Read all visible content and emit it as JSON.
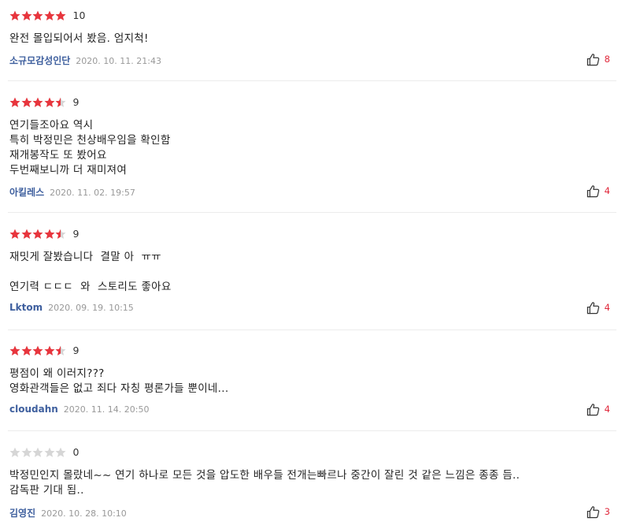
{
  "colors": {
    "star_filled": "#e8353d",
    "star_empty": "#d6d6d6",
    "nickname": "#3e5f9e",
    "like_count": "#e0283b",
    "date": "#999999"
  },
  "icons": {
    "star": "star-icon",
    "like": "thumbs-up-icon"
  },
  "reviews": [
    {
      "stars": 5,
      "score": "10",
      "lines": [
        "완전 몰입되어서 봤음. 엄지척!"
      ],
      "nickname": "소규모감성인단",
      "date": "2020. 10. 11. 21:43",
      "likes": "8"
    },
    {
      "stars": 4.5,
      "score": "9",
      "lines": [
        "연기들조아요 역시",
        "특히 박정민은 천상배우임을 확인함",
        "재개봉작도 또 봤어요",
        "두번째보니까 더 재미져여"
      ],
      "nickname": "아킬레스",
      "date": "2020. 11. 02. 19:57",
      "likes": "4"
    },
    {
      "stars": 4.5,
      "score": "9",
      "lines": [
        "재밋게 잘봤습니다  결말 아  ㅠㅠ",
        "",
        "연기력 ㄷㄷㄷ  와  스토리도 좋아요"
      ],
      "nickname": "Lktom",
      "date": "2020. 09. 19. 10:15",
      "likes": "4"
    },
    {
      "stars": 4.5,
      "score": "9",
      "lines": [
        "평점이 왜 이러지???",
        "영화관객들은 없고 죄다 자칭 평론가들 뿐이네..."
      ],
      "nickname": "cloudahn",
      "date": "2020. 11. 14. 20:50",
      "likes": "4"
    },
    {
      "stars": 0,
      "score": "0",
      "lines": [
        "박정민인지 몰랐네~~ 연기 하나로 모든 것을 압도한 배우들 전개는빠르나 중간이 잘린 것 같은 느낌은 종종 듬..",
        "감독판 기대 됨.."
      ],
      "nickname": "김영진",
      "date": "2020. 10. 28. 10:10",
      "likes": "3"
    }
  ]
}
